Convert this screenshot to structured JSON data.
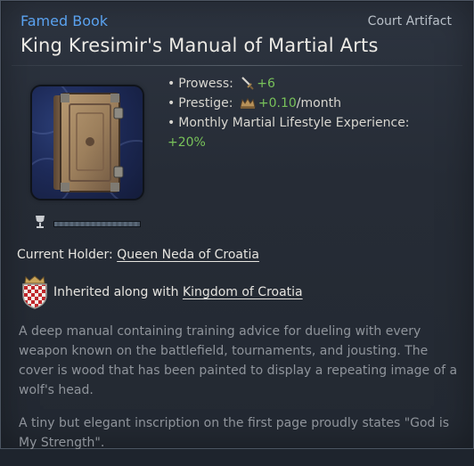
{
  "header": {
    "type_label": "Famed Book",
    "rarity_label": "Court Artifact",
    "title": "King Kresimir's Manual of Martial Arts"
  },
  "artifact": {
    "image_icon": "book-icon",
    "durability_icon": "goblet-icon",
    "durability_fraction": 1.0
  },
  "modifiers": [
    {
      "label": "Prowess:",
      "icon": "sword-icon",
      "value": "+6",
      "suffix": ""
    },
    {
      "label": "Prestige:",
      "icon": "crown-icon",
      "value": "+0.10",
      "suffix": "/month"
    },
    {
      "label": "Monthly Martial Lifestyle Experience:",
      "icon": "",
      "value": "+20%",
      "suffix": ""
    }
  ],
  "holder": {
    "label": "Current Holder:",
    "name": "Queen Neda of Croatia"
  },
  "inheritance": {
    "icon": "croatia-coat-of-arms-icon",
    "label": "Inherited along with",
    "title": "Kingdom of Croatia"
  },
  "description": [
    "A deep manual containing training advice for dueling with every weapon known on the battlefield, tournaments, and jousting. The cover is wood that has been painted to display a repeating image of a wolf's head.",
    "A tiny but elegant inscription on the first page proudly states \"God is My Strength\"."
  ],
  "colors": {
    "type_label": "#5aa2ef",
    "positive": "#78c25a",
    "description": "#8f949b",
    "title": "#eceae5"
  }
}
